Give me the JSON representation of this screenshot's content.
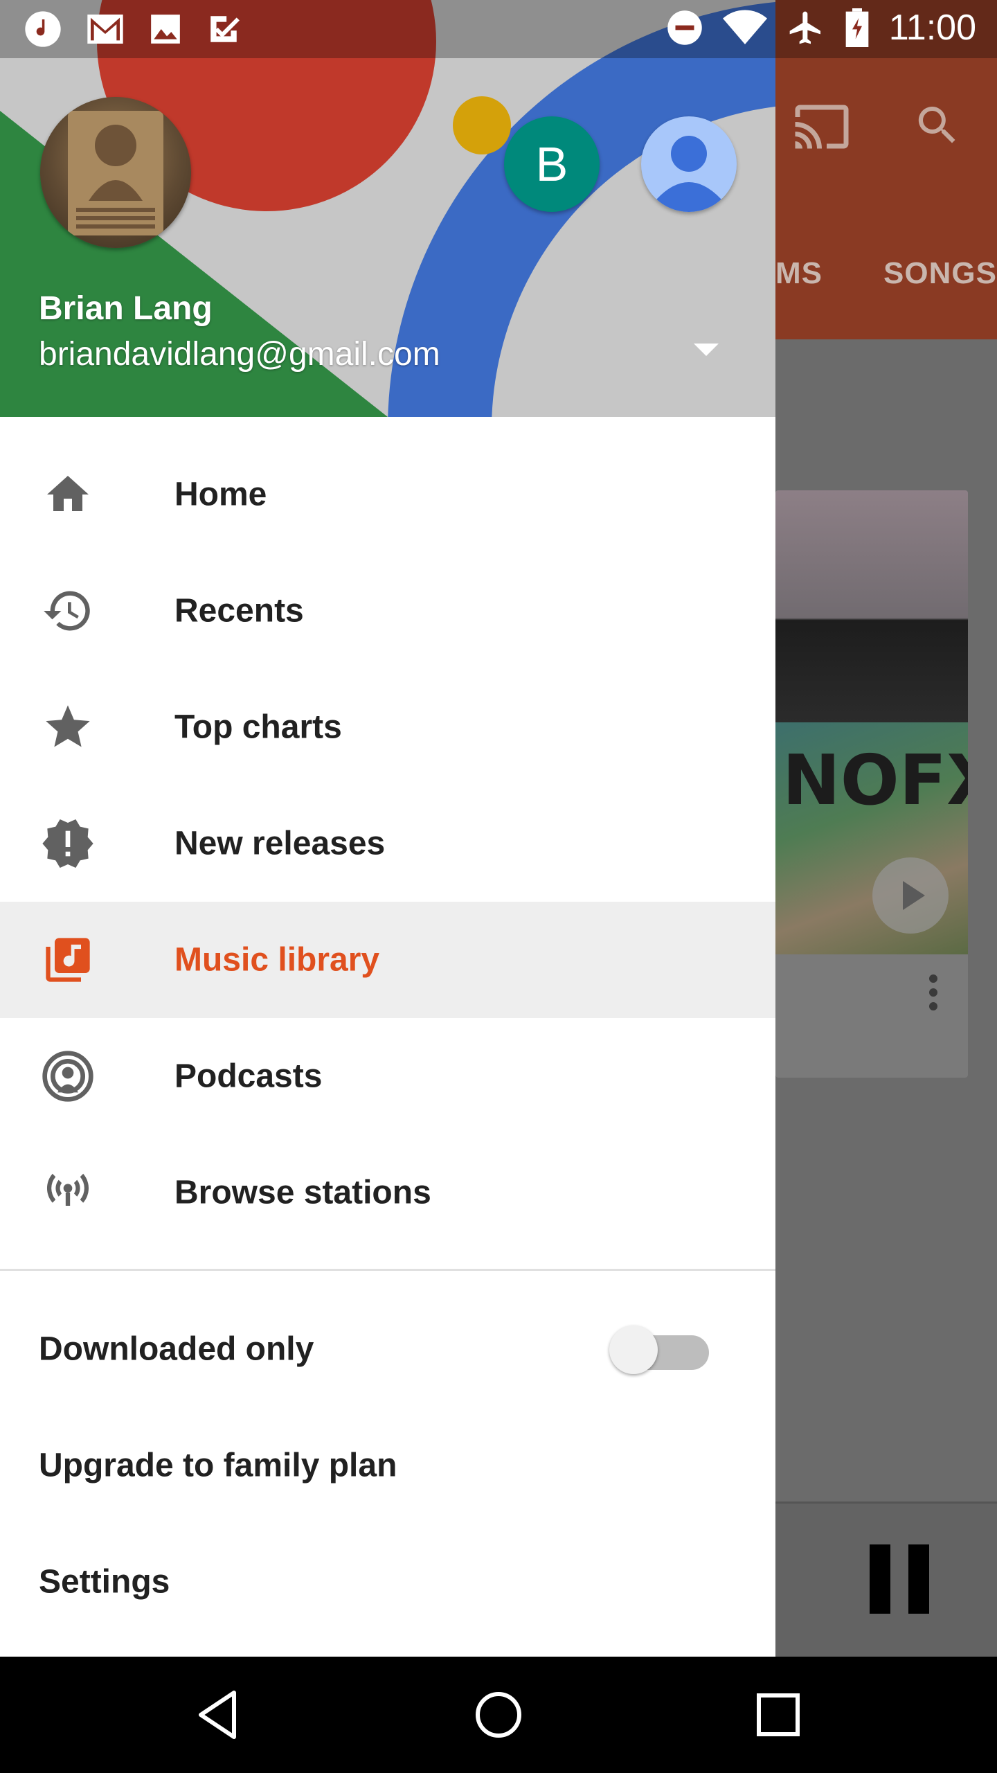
{
  "status_bar": {
    "time": "11:00",
    "left_icons": [
      "music-note-icon",
      "gmail-icon",
      "image-icon",
      "tasks-icon"
    ],
    "right_icons": [
      "do-not-disturb-icon",
      "wifi-icon",
      "airplane-icon",
      "battery-icon"
    ]
  },
  "account": {
    "name": "Brian Lang",
    "email": "briandavidlang@gmail.com",
    "secondary_avatar_initial": "B",
    "accent_colors": {
      "teal_avatar": "#00897b",
      "default_avatar": "#a8c7fa"
    }
  },
  "nav": {
    "items": [
      {
        "label": "Home",
        "icon": "home-icon"
      },
      {
        "label": "Recents",
        "icon": "history-icon"
      },
      {
        "label": "Top charts",
        "icon": "star-icon"
      },
      {
        "label": "New releases",
        "icon": "new-releases-icon"
      },
      {
        "label": "Music library",
        "icon": "library-music-icon",
        "active": true
      },
      {
        "label": "Podcasts",
        "icon": "podcast-icon"
      },
      {
        "label": "Browse stations",
        "icon": "radio-icon"
      }
    ],
    "active_color": "#e0501e"
  },
  "settings": {
    "downloaded_only": {
      "label": "Downloaded only",
      "enabled": false
    },
    "upgrade_label": "Upgrade to family plan",
    "settings_label": "Settings"
  },
  "background": {
    "tabs": [
      "MS",
      "SONGS"
    ],
    "album_art_text": "NOFX",
    "toolbar_color": "#8a3a23"
  }
}
